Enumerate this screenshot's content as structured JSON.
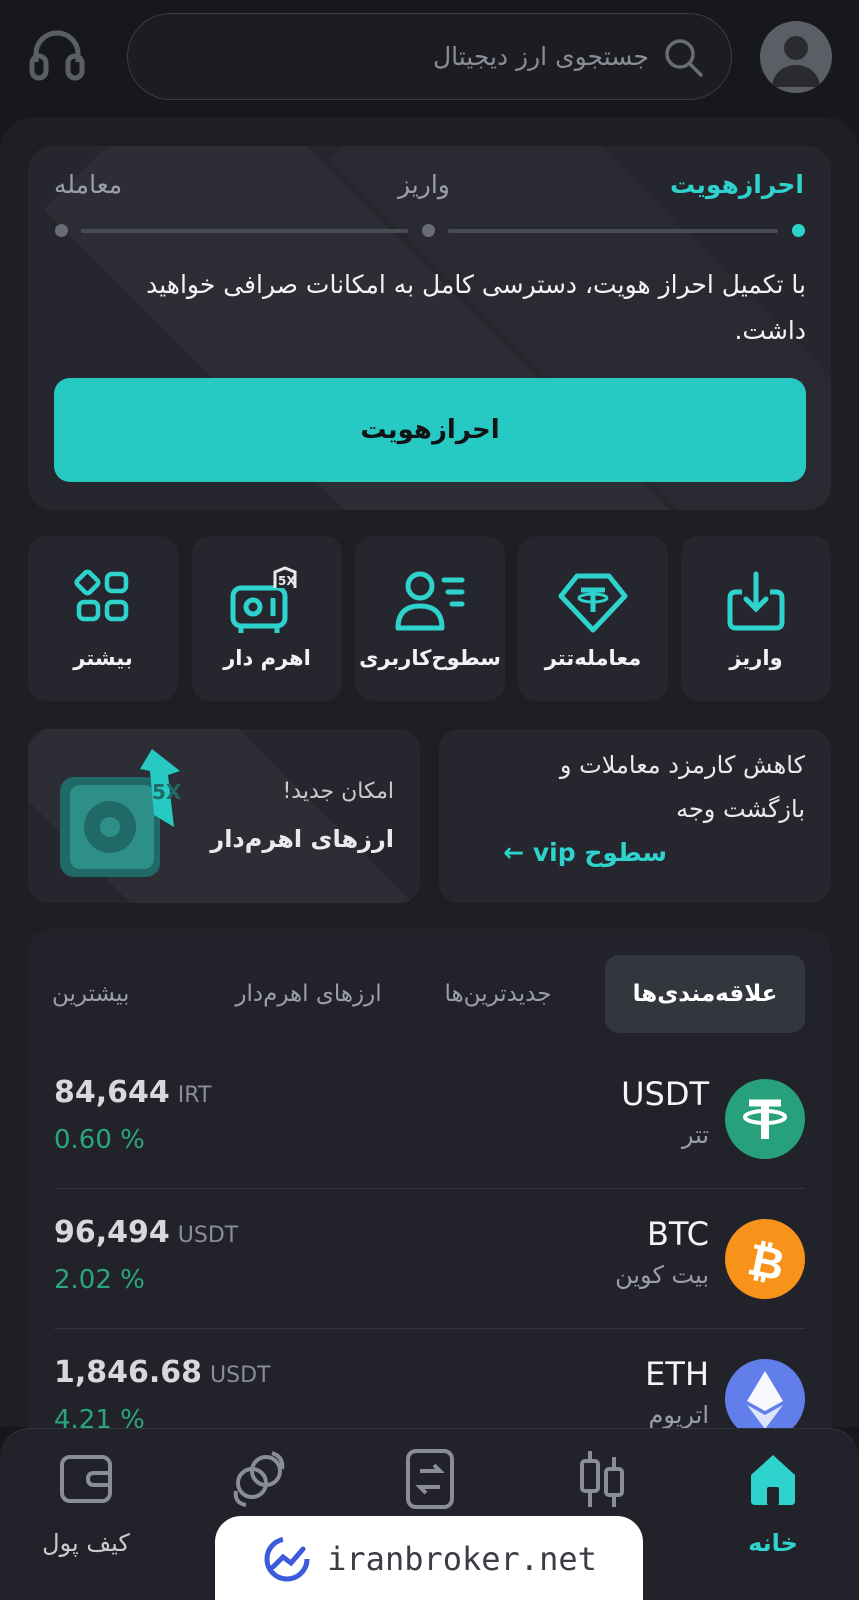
{
  "header": {
    "search_placeholder": "جستجوی ارز دیجیتال",
    "support_icon": "headset-icon",
    "avatar_icon": "user-avatar-icon"
  },
  "kyc": {
    "steps": [
      "احرازهویت",
      "واریز",
      "معامله"
    ],
    "active_step": 0,
    "description": "با تکمیل احراز هویت، دسترسی کامل به امکانات صرافی خواهید داشت.",
    "button_label": "احرازهویت"
  },
  "quick_actions": [
    {
      "label": "واریز",
      "icon": "deposit-icon"
    },
    {
      "label": "معامله‌تتر",
      "icon": "tether-trade-icon"
    },
    {
      "label": "سطوح‌کاربری",
      "icon": "user-levels-icon"
    },
    {
      "label": "اهرم دار",
      "icon": "leverage-icon"
    },
    {
      "label": "بیشتر",
      "icon": "more-apps-icon"
    }
  ],
  "promos": {
    "fee": {
      "text_line1": "کاهش کارمزد معاملات و",
      "text_line2": "بازگشت وجه",
      "link": "سطوح vip ←"
    },
    "leverage": {
      "subtitle": "امکان جدید!",
      "title": "ارزهای اهرم‌دار",
      "badge": "5X"
    }
  },
  "market": {
    "tabs": [
      "علاقه‌مندی‌ها",
      "جدیدترین‌ها",
      "ارزهای اهرم‌دار",
      "بیشترین"
    ],
    "active_tab": 0,
    "rows": [
      {
        "symbol": "USDT",
        "name": "تتر",
        "price": "84,644",
        "unit": "IRT",
        "change": "0.60 %"
      },
      {
        "symbol": "BTC",
        "name": "بیت کوین",
        "price": "96,494",
        "unit": "USDT",
        "change": "2.02 %"
      },
      {
        "symbol": "ETH",
        "name": "اتریوم",
        "price": "1,846.68",
        "unit": "USDT",
        "change": "4.21 %"
      }
    ]
  },
  "bottom_nav": [
    {
      "label": "خانه",
      "icon": "home-icon",
      "active": true
    },
    {
      "label": "",
      "icon": "candlestick-icon"
    },
    {
      "label": "",
      "icon": "exchange-icon"
    },
    {
      "label": "",
      "icon": "convert-icon"
    },
    {
      "label": "کیف پول",
      "icon": "wallet-icon"
    }
  ],
  "colors": {
    "accent": "#27c9c3",
    "background": "#17181d",
    "card": "#26272e",
    "positive": "#2aa67f"
  },
  "watermark": "iranbroker.net"
}
